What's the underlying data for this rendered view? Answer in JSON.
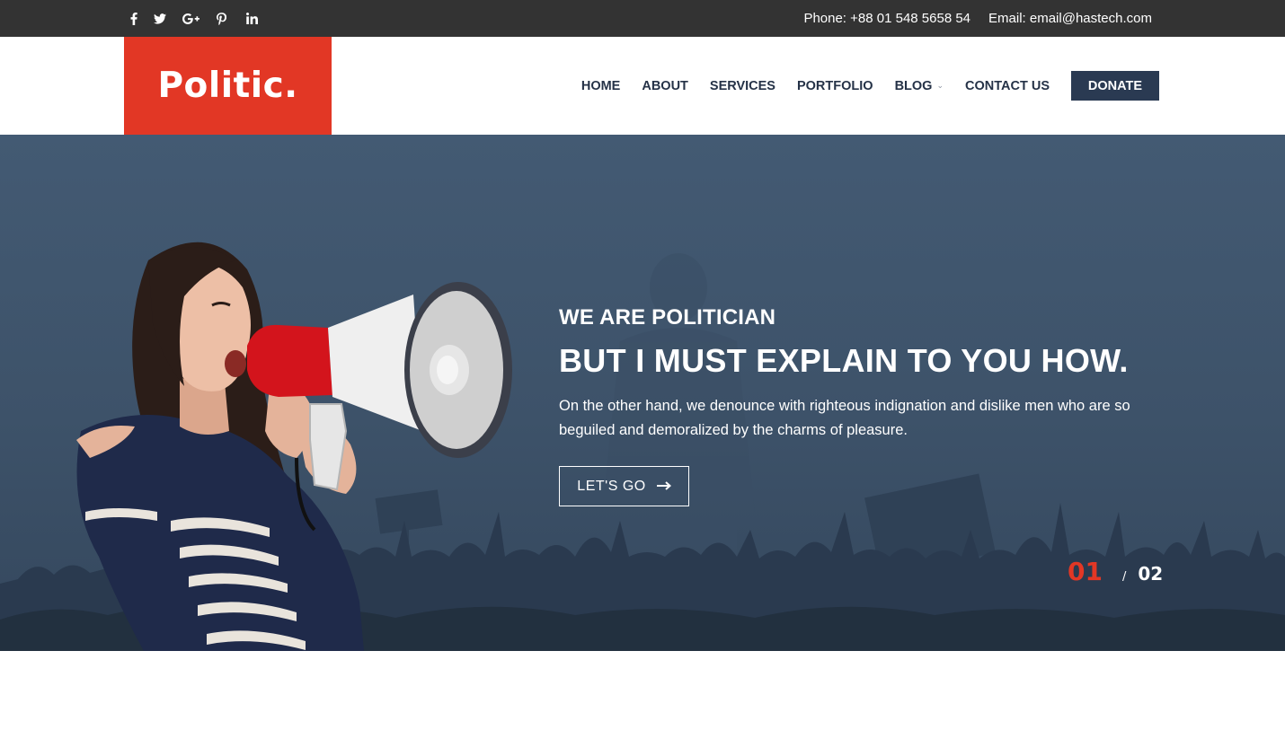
{
  "topbar": {
    "social": [
      "facebook-icon",
      "twitter-icon",
      "google-plus-icon",
      "pinterest-icon",
      "linkedin-icon"
    ],
    "phone": "Phone: +88 01 548 5658 54",
    "email": "Email: email@hastech.com"
  },
  "header": {
    "logo_text": "Politic.",
    "nav": [
      {
        "label": "HOME"
      },
      {
        "label": "ABOUT"
      },
      {
        "label": "SERVICES"
      },
      {
        "label": "PORTFOLIO"
      },
      {
        "label": "BLOG",
        "has_dropdown": true
      },
      {
        "label": "CONTACT US"
      }
    ],
    "donate_label": "DONATE"
  },
  "hero": {
    "eyebrow": "WE ARE POLITICIAN",
    "headline": "BUT I MUST EXPLAIN TO YOU HOW.",
    "lead": "On the other hand, we denounce with righteous indignation and dislike men who are so beguiled and demoralized by the charms of pleasure.",
    "cta_label": "LET'S GO",
    "slide_current": "01",
    "slide_separator": "/",
    "slide_total": "02"
  },
  "colors": {
    "accent": "#e23725",
    "nav_text": "#253247",
    "donate_bg": "#2a3a52",
    "topbar_bg": "#333333",
    "hero_bg": "#3f546c"
  }
}
